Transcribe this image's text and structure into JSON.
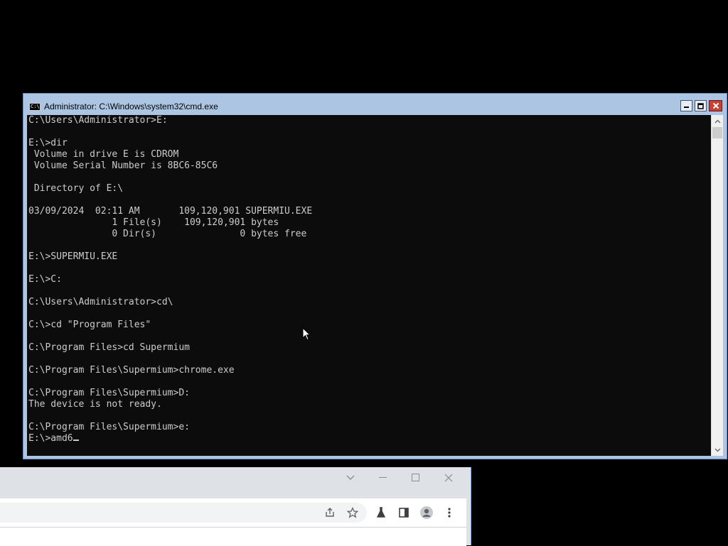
{
  "cmd": {
    "title": "Administrator: C:\\Windows\\system32\\cmd.exe",
    "icon_text": "C:\\",
    "lines": [
      "C:\\Users\\Administrator>E:",
      "",
      "E:\\>dir",
      " Volume in drive E is CDROM",
      " Volume Serial Number is 8BC6-85C6",
      "",
      " Directory of E:\\",
      "",
      "03/09/2024  02:11 AM       109,120,901 SUPERMIU.EXE",
      "               1 File(s)    109,120,901 bytes",
      "               0 Dir(s)               0 bytes free",
      "",
      "E:\\>SUPERMIU.EXE",
      "",
      "E:\\>C:",
      "",
      "C:\\Users\\Administrator>cd\\",
      "",
      "C:\\>cd \"Program Files\"",
      "",
      "C:\\Program Files>cd Supermium",
      "",
      "C:\\Program Files\\Supermium>chrome.exe",
      "",
      "C:\\Program Files\\Supermium>D:",
      "The device is not ready.",
      "",
      "C:\\Program Files\\Supermium>e:"
    ],
    "prompt_line": "E:\\>amd6",
    "buttons": {
      "minimize_icon": "minimize-icon",
      "maximize_icon": "maximize-icon",
      "close_icon": "close-icon"
    }
  },
  "browser": {
    "controls": [
      "chevron-down-icon",
      "minimize-icon",
      "maximize-icon",
      "close-icon"
    ],
    "toolbar_icons": [
      "share-icon",
      "star-icon",
      "labs-flask-icon",
      "side-panel-icon",
      "profile-icon",
      "more-vert-icon"
    ]
  },
  "colors": {
    "console_bg": "#0c0c0c",
    "console_text": "#cccccc",
    "cmd_frame": "#abc5e2",
    "close_button": "#c84033"
  }
}
